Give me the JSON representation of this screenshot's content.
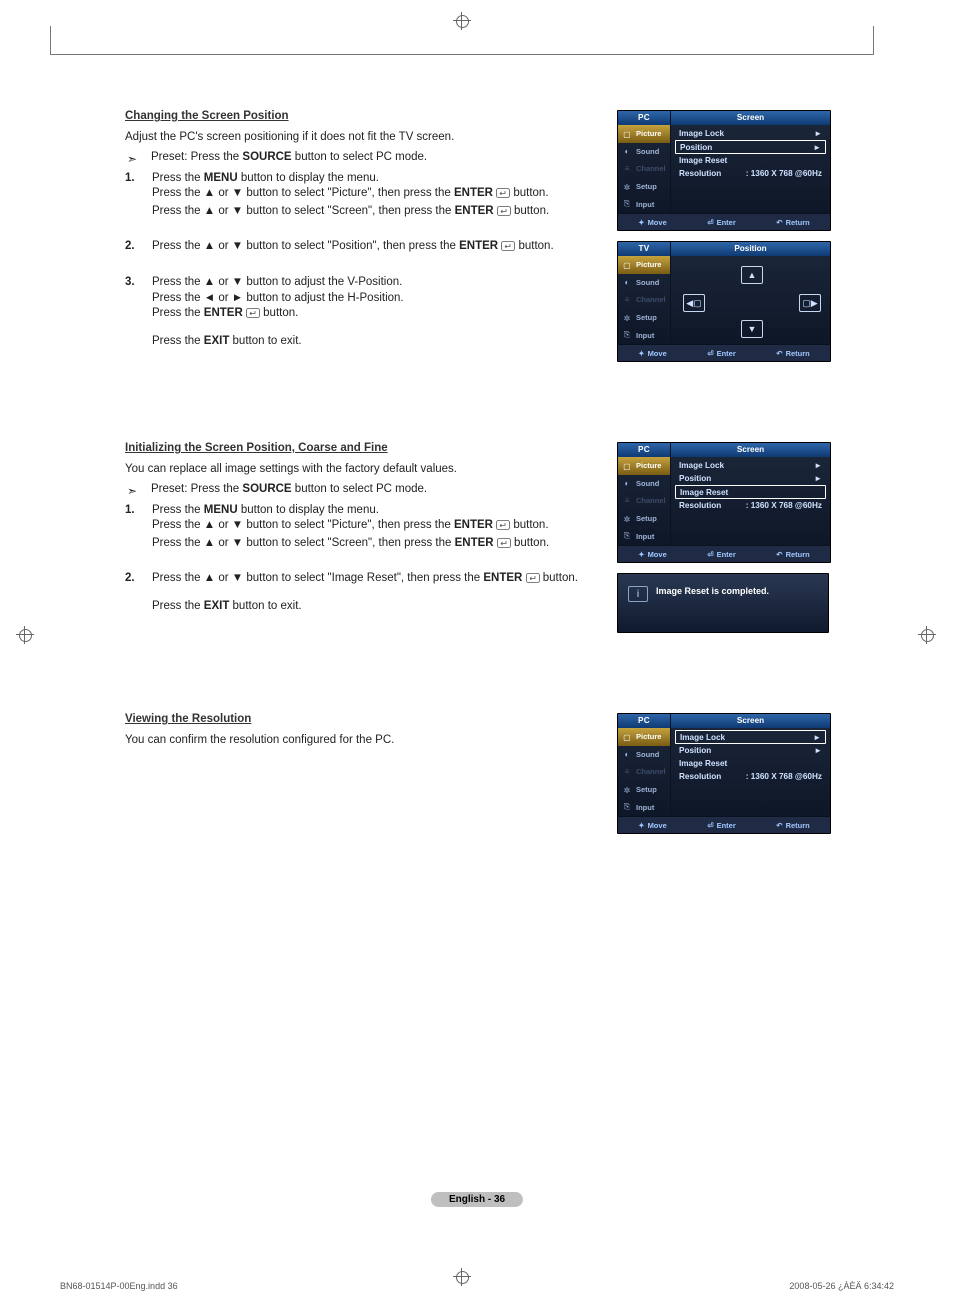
{
  "section1": {
    "title": "Changing the Screen Position",
    "intro": "Adjust the PC's screen positioning if it does not fit the TV screen.",
    "preset_pre": "Preset: Press the ",
    "preset_btn": "SOURCE",
    "preset_post": " button to select PC mode.",
    "step1_a": "Press the ",
    "step1_menu": "MENU",
    "step1_b": " button to display the menu.",
    "step1_c": "Press the ▲ or ▼ button to select \"Picture\", then press the ",
    "step1_enter": "ENTER",
    "step1_d": " button.",
    "step1_e": "Press the ▲ or ▼ button to select \"Screen\", then press the ",
    "step1_f": " button.",
    "step2_a": "Press the ▲ or ▼ button to select \"Position\", then press the ",
    "step2_b": " button.",
    "step3_a": "Press the ▲ or ▼ button to adjust the V-Position.",
    "step3_b": "Press the ◄ or ► button to adjust the H-Position.",
    "step3_c": "Press the ",
    "step3_d": " button.",
    "exit_a": "Press the ",
    "exit_btn": "EXIT",
    "exit_b": " button to exit."
  },
  "section2": {
    "title": "Initializing the Screen Position, Coarse and Fine",
    "intro": "You can replace all image settings with the factory default values.",
    "preset_pre": "Preset: Press the ",
    "preset_btn": "SOURCE",
    "preset_post": " button to select PC mode.",
    "step1_a": "Press the ",
    "step1_menu": "MENU",
    "step1_b": " button to display the menu.",
    "step1_c": "Press the ▲ or ▼ button to select \"Picture\", then press the ",
    "step1_enter": "ENTER",
    "step1_d": " button.",
    "step1_e": "Press the ▲ or ▼ button to select \"Screen\", then press the ",
    "step1_f": " button.",
    "step2_a": "Press the ▲ or ▼ button to select \"Image Reset\", then press the ",
    "step2_b": " button.",
    "exit_a": "Press the ",
    "exit_btn": "EXIT",
    "exit_b": " button to exit."
  },
  "section3": {
    "title": "Viewing the Resolution",
    "intro": "You can confirm the resolution configured for the PC."
  },
  "osd": {
    "mode_pc": "PC",
    "mode_tv": "TV",
    "title_screen": "Screen",
    "title_position": "Position",
    "side": {
      "picture": "Picture",
      "sound": "Sound",
      "channel": "Channel",
      "setup": "Setup",
      "input": "Input"
    },
    "rows": {
      "image_lock": "Image Lock",
      "position": "Position",
      "image_reset": "Image Reset",
      "resolution": "Resolution",
      "resolution_val": ": 1360 X 768 @60Hz"
    },
    "footer": {
      "move": "Move",
      "enter": "Enter",
      "return": "Return"
    },
    "popup": "Image Reset is completed."
  },
  "page_num": "English - 36",
  "doc_footer_left": "BN68-01514P-00Eng.indd   36",
  "doc_footer_right": "2008-05-26   ¿ÀÈÄ 6:34:42"
}
